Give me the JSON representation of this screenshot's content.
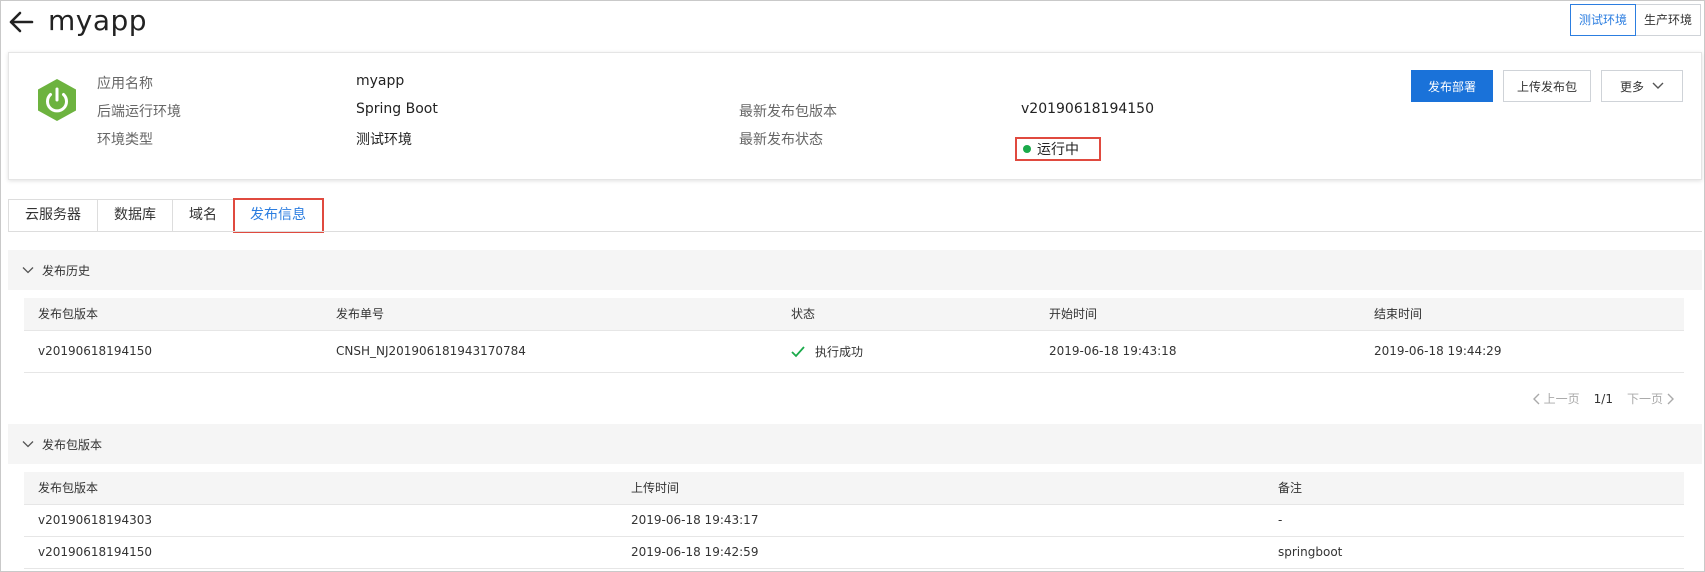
{
  "header": {
    "title": "myapp"
  },
  "env_switch": {
    "options": [
      "测试环境",
      "生产环境"
    ],
    "active": "测试环境"
  },
  "app_info": {
    "name_label": "应用名称",
    "name_value": "myapp",
    "runtime_label": "后端运行环境",
    "runtime_value": "Spring Boot",
    "env_label": "环境类型",
    "env_value": "测试环境",
    "pkg_label": "最新发布包版本",
    "pkg_value": "v20190618194150",
    "status_label": "最新发布状态",
    "status_value": "运行中",
    "status_color": "#1aaa4a"
  },
  "actions": {
    "deploy": "发布部署",
    "upload": "上传发布包",
    "more": "更多"
  },
  "tabs": [
    "云服务器",
    "数据库",
    "域名",
    "发布信息"
  ],
  "history": {
    "title": "发布历史",
    "columns": [
      "发布包版本",
      "发布单号",
      "状态",
      "开始时间",
      "结束时间"
    ],
    "rows": [
      {
        "version": "v20190618194150",
        "order": "CNSH_NJ201906181943170784",
        "status": "执行成功",
        "start": "2019-06-18 19:43:18",
        "end": "2019-06-18 19:44:29"
      }
    ],
    "pager": {
      "prev": "上一页",
      "page": "1/1",
      "next": "下一页"
    }
  },
  "packages": {
    "title": "发布包版本",
    "columns": [
      "发布包版本",
      "上传时间",
      "备注"
    ],
    "rows": [
      {
        "version": "v20190618194303",
        "time": "2019-06-18 19:43:17",
        "note": "-"
      },
      {
        "version": "v20190618194150",
        "time": "2019-06-18 19:42:59",
        "note": "springboot"
      }
    ]
  },
  "colors": {
    "primary": "#1a72d9",
    "highlight": "#e04a3f",
    "spring_green": "#6db33f"
  },
  "icons": [
    "back-arrow-icon",
    "spring-boot-logo-icon",
    "chevron-down-icon",
    "check-icon",
    "chevron-left-icon",
    "chevron-right-icon"
  ]
}
